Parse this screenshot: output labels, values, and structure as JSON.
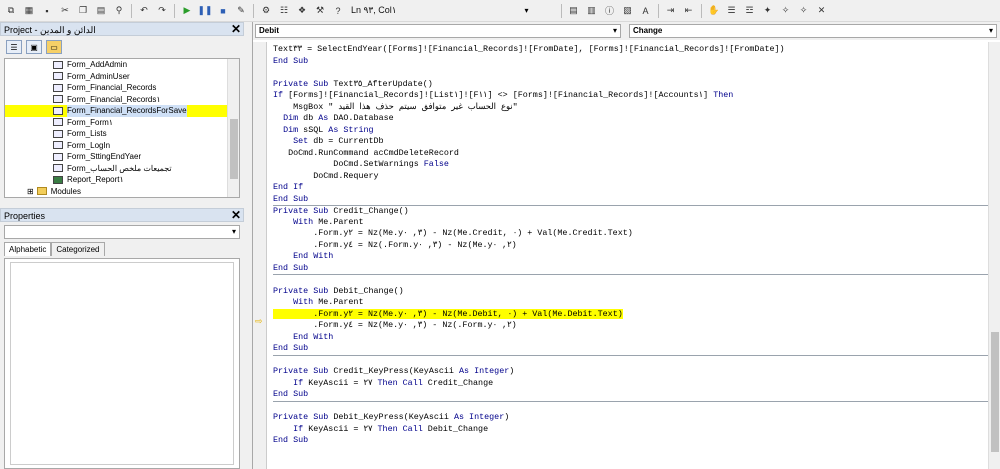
{
  "toolbar": {
    "position_label": "Ln ٩٣, Col١"
  },
  "project_pane": {
    "title": "Project - الدائن و المدين",
    "items": [
      {
        "label": "Form_AddAdmin"
      },
      {
        "label": "Form_AdminUser"
      },
      {
        "label": "Form_Financial_Records"
      },
      {
        "label": "Form_Financial_Records١"
      },
      {
        "label": "Form_Financial_RecordsForSave"
      },
      {
        "label": "Form_Form١"
      },
      {
        "label": "Form_Lists"
      },
      {
        "label": "Form_LogIn"
      },
      {
        "label": "Form_SttingEndYaer"
      },
      {
        "label": "Form_تجميعات ملخص الحساب"
      },
      {
        "label": "Report_Report١"
      },
      {
        "label": "Modules"
      }
    ]
  },
  "properties_pane": {
    "title": "Properties",
    "tab_alphabetic": "Alphabetic",
    "tab_categorized": "Categorized"
  },
  "editor": {
    "object_combo": "Debit",
    "proc_combo": "Change",
    "lines": [
      {
        "t": "Text٣٣ = SelectEndYear([Forms]![Financial_Records]![FromDate], [Forms]![Financial_Records]![FromDate])"
      },
      {
        "t": "End Sub"
      },
      {
        "t": ""
      },
      {
        "t": "Private Sub Text٣٥_AfterUpdate()"
      },
      {
        "t": "If [Forms]![Financial_Records]![List١]![F١١] <> [Forms]![Financial_Records]![Accounts١] Then"
      },
      {
        "t": "    MsgBox \" نوع الحساب غير متوافق سيتم حذف هذا القيد\""
      },
      {
        "t": "  Dim db As DAO.Database"
      },
      {
        "t": "  Dim sSQL As String"
      },
      {
        "t": "    Set db = CurrentDb"
      },
      {
        "t": "   DoCmd.RunCommand acCmdDeleteRecord"
      },
      {
        "t": "            DoCmd.SetWarnings False"
      },
      {
        "t": "        DoCmd.Requery"
      },
      {
        "t": "End If"
      },
      {
        "t": "End Sub"
      },
      {
        "t": "Private Sub Credit_Change()",
        "sep": true
      },
      {
        "t": "    With Me.Parent"
      },
      {
        "t": "        .Form.y٢ = Nz(Me.y٣, ٠) - Nz(Me.Credit, ٠) + Val(Me.Credit.Text)"
      },
      {
        "t": "        .Form.y٤ = Nz(.Form.y٣, ٠) - Nz(Me.y٢, ٠)"
      },
      {
        "t": "    End With"
      },
      {
        "t": "End Sub"
      },
      {
        "t": "",
        "sep": true
      },
      {
        "t": "Private Sub Debit_Change()"
      },
      {
        "t": "    With Me.Parent"
      },
      {
        "t": "        .Form.y٢ = Nz(Me.y٣, ٠) - Nz(Me.Debit, ٠) + Val(Me.Debit.Text)",
        "hl": true
      },
      {
        "t": "        .Form.y٤ = Nz(Me.y٣, ٠) - Nz(.Form.y٢, ٠)"
      },
      {
        "t": "    End With"
      },
      {
        "t": "End Sub"
      },
      {
        "t": "",
        "sep": true
      },
      {
        "t": "Private Sub Credit_KeyPress(KeyAscii As Integer)"
      },
      {
        "t": "    If KeyAscii = ٢٧ Then Call Credit_Change"
      },
      {
        "t": "End Sub"
      },
      {
        "t": "",
        "sep": true
      },
      {
        "t": "Private Sub Debit_KeyPress(KeyAscii As Integer)"
      },
      {
        "t": "    If KeyAscii = ٢٧ Then Call Debit_Change"
      },
      {
        "t": "End Sub"
      }
    ]
  }
}
